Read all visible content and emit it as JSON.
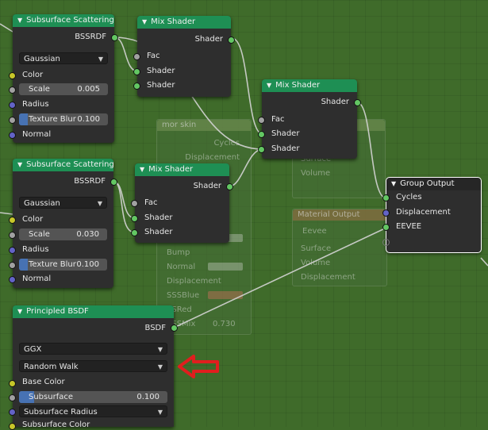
{
  "nodes": {
    "sss1": {
      "title": "Subsurface Scattering",
      "output": "BSSRDF",
      "method": "Gaussian",
      "color_label": "Color",
      "scale_label": "Scale",
      "scale_value": "0.005",
      "radius_label": "Radius",
      "texture_blur_label": "Texture Blur",
      "texture_blur_value": "0.100",
      "texture_blur_fraction": 0.1,
      "normal_label": "Normal"
    },
    "sss2": {
      "title": "Subsurface Scattering",
      "output": "BSSRDF",
      "method": "Gaussian",
      "color_label": "Color",
      "scale_label": "Scale",
      "scale_value": "0.030",
      "radius_label": "Radius",
      "texture_blur_label": "Texture Blur",
      "texture_blur_value": "0.100",
      "texture_blur_fraction": 0.1,
      "normal_label": "Normal"
    },
    "mix1": {
      "title": "Mix Shader",
      "output": "Shader",
      "fac": "Fac",
      "shader1": "Shader",
      "shader2": "Shader"
    },
    "mix2": {
      "title": "Mix Shader",
      "output": "Shader",
      "fac": "Fac",
      "shader1": "Shader",
      "shader2": "Shader"
    },
    "mix3": {
      "title": "Mix Shader",
      "output": "Shader",
      "fac": "Fac",
      "shader1": "Shader",
      "shader2": "Shader"
    },
    "group_output": {
      "title": "Group Output",
      "cycles": "Cycles",
      "displacement": "Displacement",
      "eevee": "EEVEE"
    },
    "principled": {
      "title": "Principled BSDF",
      "output": "BSDF",
      "distribution": "GGX",
      "subsurface_method": "Random Walk",
      "base_color_label": "Base Color",
      "subsurface_label": "Subsurface",
      "subsurface_value": "0.100",
      "subsurface_fraction": 0.1,
      "subsurface_radius_label": "Subsurface Radius",
      "subsurface_color_label": "Subsurface Color"
    }
  },
  "ghost_nodes": {
    "frame_title": "mor skin",
    "frame_outputs": [
      "Cycles",
      "Displacement"
    ],
    "frame_inputs": [
      "Bump",
      "Normal",
      "Displacement",
      "SSSBlue",
      "SSRed",
      "SSSMix"
    ],
    "frame_value": "0.730",
    "material_output_1": {
      "labels": [
        "Surface",
        "Volume",
        "Displacement"
      ]
    },
    "material_output_2": {
      "title": "Material Output",
      "target": "Eevee",
      "labels": [
        "Surface",
        "Volume",
        "Displacement"
      ]
    }
  },
  "colors": {
    "background": "#3f6b2a",
    "node_body": "#2e2e2e",
    "shader_header": "#1e8f54",
    "link": "#d4d4d4",
    "arrow": "#e01e1e"
  },
  "icons": {
    "annotation": "red-arrow-left-icon",
    "collapse": "chevron-down-icon"
  }
}
